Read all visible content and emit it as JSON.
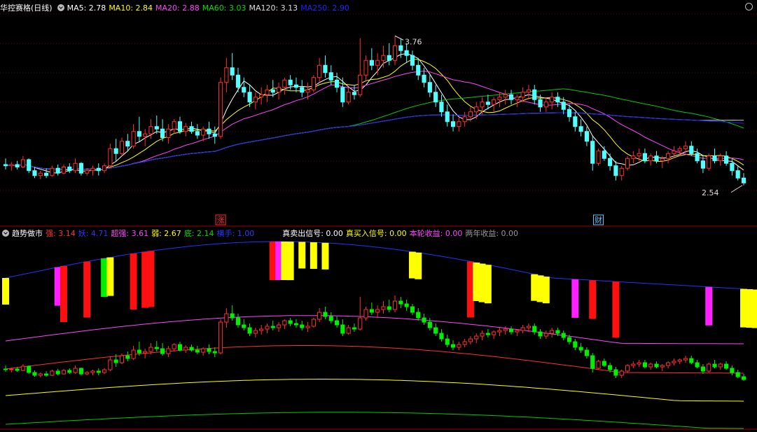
{
  "header": {
    "stock_label": "华控赛格(日线)",
    "ma_items": [
      {
        "text": "MA5: 2.78",
        "color": "#ffffff"
      },
      {
        "text": "MA10: 2.84",
        "color": "#ffff00"
      },
      {
        "text": "MA20: 2.88",
        "color": "#ff44ff"
      },
      {
        "text": "MA60: 3.03",
        "color": "#00dd00"
      },
      {
        "text": "MA120: 3.13",
        "color": "#dddddd"
      },
      {
        "text": "MA250: 2.90",
        "color": "#2222ff"
      }
    ]
  },
  "indicator": {
    "name": "趋势做市",
    "items": [
      {
        "text": "强: 3.14",
        "color": "#ff3030"
      },
      {
        "text": "妖: 4.71",
        "color": "#3333ff"
      },
      {
        "text": "超强: 3.61",
        "color": "#ff44ff"
      },
      {
        "text": "弱: 2.67",
        "color": "#ffff00"
      },
      {
        "text": "底: 2.14",
        "color": "#00dd00"
      },
      {
        "text": "横手: 1.00",
        "color": "#3333ff"
      },
      {
        "text": "真卖出信号: 0.00",
        "color": "#ffffff"
      },
      {
        "text": "真买入信号: 0.00",
        "color": "#ffff00"
      },
      {
        "text": "本轮收益: 0.00",
        "color": "#ff44ff"
      },
      {
        "text": "两年收益: 0.00",
        "color": "#999999"
      }
    ]
  },
  "chart_data": {
    "type": "candlestick",
    "high_label": "3.76",
    "low_label": "2.54",
    "markers": [
      {
        "text": "涨",
        "color": "#ff3030",
        "index": 37
      },
      {
        "text": "财",
        "color": "#5fc8ff",
        "index": 102
      }
    ],
    "ylim": [
      2.35,
      3.95
    ],
    "candles": [
      [
        2.71,
        2.76,
        2.67,
        2.7
      ],
      [
        2.7,
        2.73,
        2.66,
        2.71
      ],
      [
        2.71,
        2.74,
        2.67,
        2.69
      ],
      [
        2.69,
        2.78,
        2.68,
        2.75
      ],
      [
        2.75,
        2.76,
        2.64,
        2.66
      ],
      [
        2.66,
        2.69,
        2.6,
        2.62
      ],
      [
        2.62,
        2.66,
        2.59,
        2.64
      ],
      [
        2.64,
        2.68,
        2.6,
        2.62
      ],
      [
        2.62,
        2.7,
        2.61,
        2.68
      ],
      [
        2.68,
        2.71,
        2.62,
        2.64
      ],
      [
        2.64,
        2.71,
        2.63,
        2.69
      ],
      [
        2.69,
        2.72,
        2.64,
        2.66
      ],
      [
        2.66,
        2.76,
        2.64,
        2.72
      ],
      [
        2.72,
        2.73,
        2.62,
        2.64
      ],
      [
        2.64,
        2.68,
        2.62,
        2.66
      ],
      [
        2.66,
        2.7,
        2.62,
        2.68
      ],
      [
        2.68,
        2.72,
        2.62,
        2.66
      ],
      [
        2.66,
        2.72,
        2.64,
        2.7
      ],
      [
        2.7,
        2.88,
        2.68,
        2.84
      ],
      [
        2.84,
        2.92,
        2.74,
        2.8
      ],
      [
        2.8,
        2.93,
        2.78,
        2.9
      ],
      [
        2.9,
        2.96,
        2.82,
        2.86
      ],
      [
        2.86,
        3.04,
        2.84,
        2.98
      ],
      [
        2.98,
        3.1,
        2.9,
        2.94
      ],
      [
        2.94,
        3.0,
        2.86,
        2.96
      ],
      [
        2.96,
        3.08,
        2.92,
        3.02
      ],
      [
        3.02,
        3.11,
        2.96,
        3.0
      ],
      [
        3.0,
        3.08,
        2.9,
        2.93
      ],
      [
        2.93,
        3.04,
        2.88,
        3.0
      ],
      [
        3.0,
        3.08,
        2.96,
        3.06
      ],
      [
        3.06,
        3.1,
        2.96,
        2.98
      ],
      [
        2.98,
        3.05,
        2.94,
        3.02
      ],
      [
        3.02,
        3.06,
        2.96,
        2.98
      ],
      [
        2.98,
        3.04,
        2.92,
        2.95
      ],
      [
        2.95,
        3.02,
        2.9,
        3.0
      ],
      [
        3.0,
        3.06,
        2.92,
        2.96
      ],
      [
        2.96,
        3.02,
        2.88,
        2.94
      ],
      [
        2.94,
        3.42,
        2.92,
        3.38
      ],
      [
        3.38,
        3.58,
        3.3,
        3.5
      ],
      [
        3.5,
        3.62,
        3.4,
        3.44
      ],
      [
        3.44,
        3.5,
        3.3,
        3.34
      ],
      [
        3.34,
        3.42,
        3.26,
        3.3
      ],
      [
        3.3,
        3.36,
        3.18,
        3.22
      ],
      [
        3.22,
        3.3,
        3.16,
        3.26
      ],
      [
        3.26,
        3.34,
        3.2,
        3.28
      ],
      [
        3.28,
        3.36,
        3.22,
        3.32
      ],
      [
        3.32,
        3.4,
        3.26,
        3.3
      ],
      [
        3.3,
        3.38,
        3.24,
        3.34
      ],
      [
        3.34,
        3.42,
        3.28,
        3.4
      ],
      [
        3.4,
        3.44,
        3.32,
        3.36
      ],
      [
        3.36,
        3.42,
        3.3,
        3.34
      ],
      [
        3.34,
        3.4,
        3.26,
        3.3
      ],
      [
        3.3,
        3.38,
        3.24,
        3.32
      ],
      [
        3.32,
        3.44,
        3.3,
        3.42
      ],
      [
        3.42,
        3.58,
        3.38,
        3.52
      ],
      [
        3.52,
        3.6,
        3.42,
        3.46
      ],
      [
        3.46,
        3.52,
        3.36,
        3.4
      ],
      [
        3.4,
        3.46,
        3.3,
        3.34
      ],
      [
        3.34,
        3.42,
        3.18,
        3.22
      ],
      [
        3.22,
        3.34,
        3.2,
        3.3
      ],
      [
        3.3,
        3.36,
        3.24,
        3.28
      ],
      [
        3.28,
        3.74,
        3.26,
        3.44
      ],
      [
        3.44,
        3.6,
        3.4,
        3.56
      ],
      [
        3.56,
        3.66,
        3.48,
        3.52
      ],
      [
        3.52,
        3.62,
        3.44,
        3.56
      ],
      [
        3.56,
        3.68,
        3.5,
        3.6
      ],
      [
        3.6,
        3.7,
        3.52,
        3.56
      ],
      [
        3.56,
        3.76,
        3.52,
        3.68
      ],
      [
        3.68,
        3.74,
        3.58,
        3.64
      ],
      [
        3.64,
        3.7,
        3.54,
        3.6
      ],
      [
        3.6,
        3.64,
        3.48,
        3.52
      ],
      [
        3.52,
        3.58,
        3.4,
        3.44
      ],
      [
        3.44,
        3.5,
        3.34,
        3.38
      ],
      [
        3.38,
        3.44,
        3.26,
        3.3
      ],
      [
        3.3,
        3.36,
        3.18,
        3.22
      ],
      [
        3.22,
        3.28,
        3.1,
        3.14
      ],
      [
        3.14,
        3.2,
        3.02,
        3.06
      ],
      [
        3.06,
        3.12,
        2.98,
        3.02
      ],
      [
        3.02,
        3.1,
        2.98,
        3.06
      ],
      [
        3.06,
        3.14,
        3.02,
        3.1
      ],
      [
        3.1,
        3.18,
        3.06,
        3.14
      ],
      [
        3.14,
        3.22,
        3.08,
        3.18
      ],
      [
        3.18,
        3.26,
        3.12,
        3.22
      ],
      [
        3.22,
        3.28,
        3.16,
        3.2
      ],
      [
        3.2,
        3.26,
        3.14,
        3.24
      ],
      [
        3.24,
        3.3,
        3.18,
        3.26
      ],
      [
        3.26,
        3.32,
        3.2,
        3.28
      ],
      [
        3.28,
        3.32,
        3.2,
        3.24
      ],
      [
        3.24,
        3.28,
        3.18,
        3.26
      ],
      [
        3.26,
        3.34,
        3.22,
        3.3
      ],
      [
        3.3,
        3.36,
        3.24,
        3.32
      ],
      [
        3.32,
        3.36,
        3.2,
        3.24
      ],
      [
        3.24,
        3.28,
        3.14,
        3.18
      ],
      [
        3.18,
        3.26,
        3.14,
        3.22
      ],
      [
        3.22,
        3.3,
        3.16,
        3.26
      ],
      [
        3.26,
        3.3,
        3.18,
        3.22
      ],
      [
        3.22,
        3.26,
        3.12,
        3.16
      ],
      [
        3.16,
        3.2,
        3.06,
        3.1
      ],
      [
        3.1,
        3.14,
        2.98,
        3.02
      ],
      [
        3.02,
        3.08,
        2.94,
        2.98
      ],
      [
        2.98,
        3.02,
        2.86,
        2.9
      ],
      [
        2.9,
        2.94,
        2.66,
        2.72
      ],
      [
        2.72,
        2.84,
        2.7,
        2.82
      ],
      [
        2.82,
        2.86,
        2.74,
        2.76
      ],
      [
        2.76,
        2.8,
        2.66,
        2.7
      ],
      [
        2.7,
        2.74,
        2.58,
        2.62
      ],
      [
        2.62,
        2.7,
        2.58,
        2.68
      ],
      [
        2.68,
        2.78,
        2.66,
        2.76
      ],
      [
        2.76,
        2.82,
        2.72,
        2.78
      ],
      [
        2.78,
        2.84,
        2.74,
        2.8
      ],
      [
        2.8,
        2.84,
        2.72,
        2.74
      ],
      [
        2.74,
        2.8,
        2.7,
        2.78
      ],
      [
        2.78,
        2.82,
        2.72,
        2.74
      ],
      [
        2.74,
        2.78,
        2.68,
        2.76
      ],
      [
        2.76,
        2.82,
        2.72,
        2.8
      ],
      [
        2.8,
        2.86,
        2.76,
        2.82
      ],
      [
        2.82,
        2.86,
        2.78,
        2.84
      ],
      [
        2.84,
        2.9,
        2.8,
        2.86
      ],
      [
        2.86,
        2.9,
        2.78,
        2.8
      ],
      [
        2.8,
        2.84,
        2.72,
        2.74
      ],
      [
        2.74,
        2.78,
        2.64,
        2.68
      ],
      [
        2.68,
        2.8,
        2.66,
        2.78
      ],
      [
        2.78,
        2.84,
        2.72,
        2.74
      ],
      [
        2.74,
        2.8,
        2.7,
        2.78
      ],
      [
        2.78,
        2.82,
        2.7,
        2.72
      ],
      [
        2.72,
        2.76,
        2.62,
        2.66
      ],
      [
        2.66,
        2.7,
        2.58,
        2.6
      ],
      [
        2.6,
        2.64,
        2.54,
        2.56
      ]
    ],
    "signal_bars": [
      {
        "index": 0,
        "top": "yellow",
        "span": "short"
      },
      {
        "index": 9,
        "top": "magenta",
        "span": "mid"
      },
      {
        "index": 10,
        "top": "red",
        "span": "long"
      },
      {
        "index": 14,
        "top": "red",
        "span": "long"
      },
      {
        "index": 17,
        "top": "green",
        "span": "mid"
      },
      {
        "index": 18,
        "top": "yellow",
        "span": "mid"
      },
      {
        "index": 22,
        "top": "red",
        "span": "long"
      },
      {
        "index": 24,
        "top": "red",
        "span": "long"
      },
      {
        "index": 25,
        "top": "red",
        "span": "long"
      },
      {
        "index": 46,
        "top": "red",
        "span": "mid"
      },
      {
        "index": 47,
        "top": "magenta",
        "span": "mid"
      },
      {
        "index": 48,
        "top": "yellow",
        "span": "mid"
      },
      {
        "index": 49,
        "top": "yellow",
        "span": "mid"
      },
      {
        "index": 51,
        "top": "yellow",
        "span": "short"
      },
      {
        "index": 53,
        "top": "yellow",
        "span": "short"
      },
      {
        "index": 55,
        "top": "yellow",
        "span": "short"
      },
      {
        "index": 70,
        "top": "yellow",
        "span": "short"
      },
      {
        "index": 71,
        "top": "yellow",
        "span": "short"
      },
      {
        "index": 80,
        "top": "red",
        "span": "long"
      },
      {
        "index": 81,
        "top": "yellow",
        "span": "mid"
      },
      {
        "index": 82,
        "top": "yellow",
        "span": "mid"
      },
      {
        "index": 83,
        "top": "yellow",
        "span": "mid"
      },
      {
        "index": 91,
        "top": "yellow",
        "span": "short"
      },
      {
        "index": 92,
        "top": "yellow",
        "span": "short"
      },
      {
        "index": 93,
        "top": "yellow",
        "span": "short"
      },
      {
        "index": 98,
        "top": "magenta",
        "span": "mid"
      },
      {
        "index": 101,
        "top": "red",
        "span": "mid"
      },
      {
        "index": 105,
        "top": "red",
        "span": "long"
      },
      {
        "index": 121,
        "top": "magenta",
        "span": "mid"
      },
      {
        "index": 127,
        "top": "yellow",
        "span": "mid"
      },
      {
        "index": 128,
        "top": "yellow",
        "span": "mid"
      },
      {
        "index": 129,
        "top": "yellow",
        "span": "mid"
      },
      {
        "index": 132,
        "top": "yellow",
        "span": "short"
      },
      {
        "index": 133,
        "top": "yellow",
        "span": "short"
      },
      {
        "index": 134,
        "top": "yellow",
        "span": "short"
      },
      {
        "index": 139,
        "top": "magenta",
        "span": "mid"
      },
      {
        "index": 140,
        "top": "red",
        "span": "long"
      },
      {
        "index": 141,
        "top": "yellow",
        "span": "mid"
      },
      {
        "index": 175,
        "top": "magenta",
        "span": "mid"
      }
    ]
  },
  "colors": {
    "up": "#ff3030",
    "down": "#54ffff",
    "ma5": "#ffffff",
    "ma10": "#ffff00",
    "ma20": "#ff44ff",
    "ma60": "#00cc00",
    "ma120": "#cccccc",
    "ma250": "#2222ff",
    "grid": "#6a0000",
    "sub_up": "#ff3030",
    "sub_down": "#00ee00"
  }
}
